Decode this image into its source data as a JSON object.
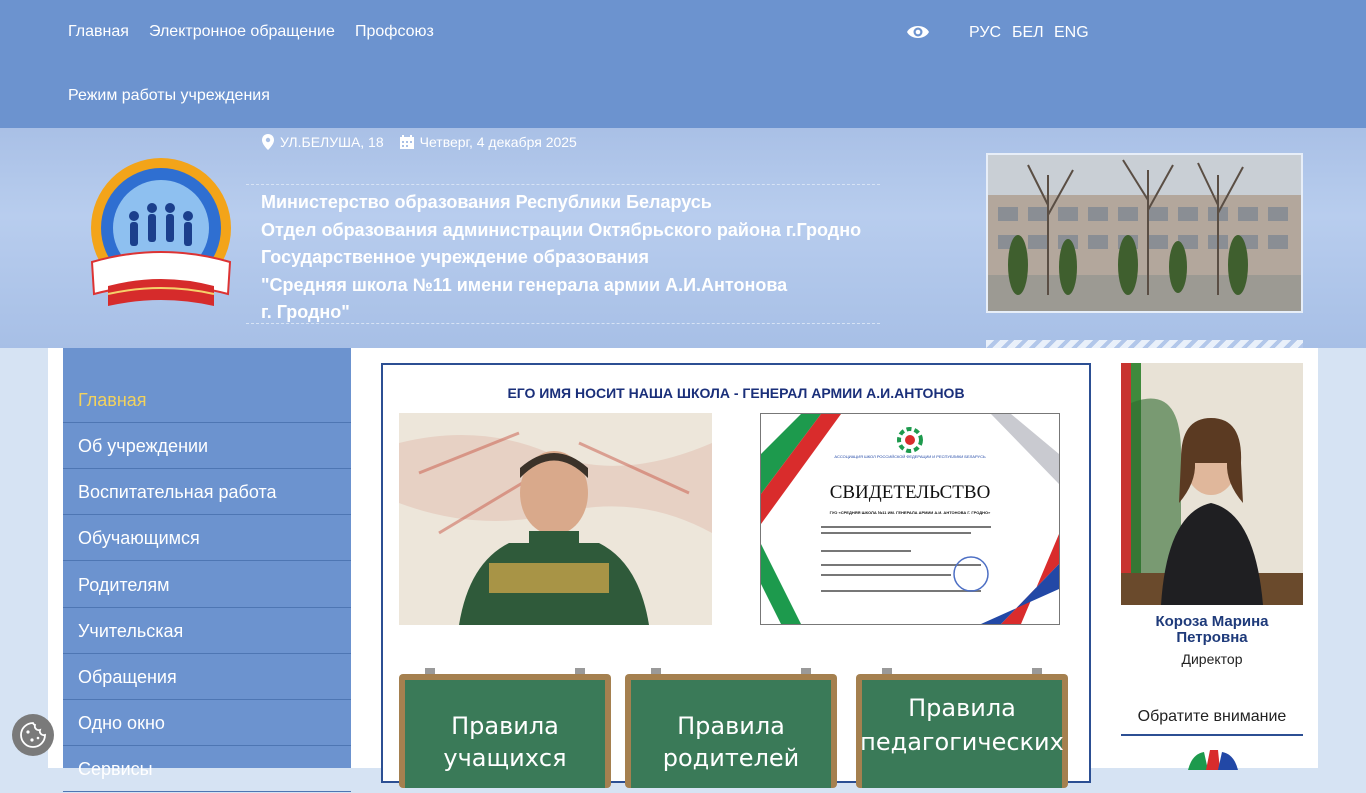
{
  "nav": {
    "items": [
      "Главная",
      "Электронное обращение",
      "Профсоюз",
      "Режим работы учреждения"
    ],
    "languages": [
      "РУС",
      "БЕЛ",
      "ENG"
    ],
    "accessibility_icon": "eye-icon"
  },
  "header": {
    "address": "УЛ.БЕЛУША, 18",
    "date": "Четверг, 4 декабря 2025",
    "org_lines": [
      "Министерство образования Республики Беларусь",
      "Отдел образования администрации Октябрьского района г.Гродно",
      "Государственное учреждение образования",
      "\"Средняя школа №11 имени генерала армии А.И.Антонова",
      "г. Гродно\""
    ],
    "logo_text": "Государственное учреждение образования «Средняя школа №11 имени генерала армии А.И.Антонова г. Гродно»"
  },
  "sidebar": {
    "items": [
      "Главная",
      "Об учреждении",
      "Воспитательная работа",
      "Обучающимся",
      "Родителям",
      "Учительская",
      "Обращения",
      "Одно окно",
      "Сервисы"
    ]
  },
  "main": {
    "title": "ЕГО ИМЯ НОСИТ НАША ШКОЛА - ГЕНЕРАЛ АРМИИ А.И.АНТОНОВ",
    "certificate": {
      "org_name": "АССОЦИАЦИЯ ШКОЛ РОССИЙСКОЙ ФЕДЕРАЦИИ И РЕСПУБЛИКИ БЕЛАРУСЬ",
      "heading": "СВИДЕТЕЛЬСТВО",
      "recipient": "ГУО «СРЕДНЯЯ ШКОЛА №11 ИМ. ГЕНЕРАЛА АРМИИ А.И. АНТОНОВА Г. ГРОДНО»"
    },
    "boards": [
      [
        "Правила",
        "учащихся"
      ],
      [
        "Правила",
        "родителей"
      ],
      [
        "Правила",
        "педагогических"
      ]
    ]
  },
  "director": {
    "name": "Короза Марина Петровна",
    "role": "Директор"
  },
  "attention_label": "Обратите внимание",
  "colors": {
    "nav": "#6c93cf",
    "active": "#f2d25e",
    "title": "#1a2f7a"
  }
}
